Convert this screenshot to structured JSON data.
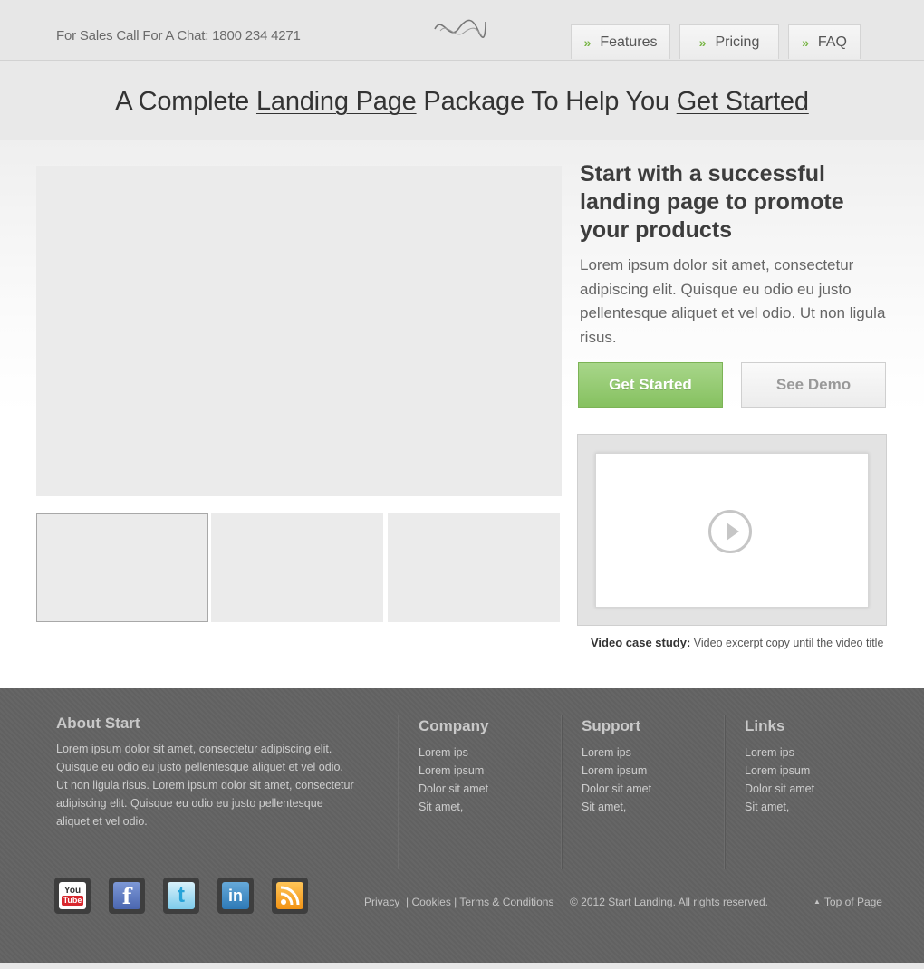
{
  "header": {
    "sales_text": "For Sales Call For A Chat: 1800 234 4271",
    "nav": [
      {
        "label": "Features"
      },
      {
        "label": "Pricing"
      },
      {
        "label": "FAQ"
      }
    ]
  },
  "headline": {
    "part1": "A Complete ",
    "link1": "Landing Page",
    "part2": " Package To Help You ",
    "link2": "Get Started"
  },
  "hero": {
    "title": "Start with a successful landing page to promote your products",
    "text": "Lorem ipsum dolor sit amet, consectetur adipiscing elit. Quisque eu odio eu justo pellentesque aliquet et vel odio. Ut non ligula risus.",
    "primary_button": "Get Started",
    "secondary_button": "See Demo",
    "video_caption_label": "Video case study:",
    "video_caption_text": " Video excerpt copy until the video title"
  },
  "footer": {
    "about_title": "About Start",
    "about_text": "Lorem ipsum dolor sit amet, consectetur adipiscing elit. Quisque eu odio eu justo pellentesque aliquet et vel odio. Ut non ligula risus.  Lorem ipsum dolor sit amet, consectetur adipiscing elit. Quisque eu odio eu justo pellentesque aliquet et vel odio.",
    "columns": [
      {
        "title": "Company",
        "items": [
          "Lorem ips",
          "Lorem ipsum",
          "Dolor sit amet",
          "Sit amet,"
        ]
      },
      {
        "title": "Support",
        "items": [
          "Lorem ips",
          "Lorem ipsum",
          "Dolor sit amet",
          "Sit amet,"
        ]
      },
      {
        "title": "Links",
        "items": [
          "Lorem ips",
          "Lorem ipsum",
          "Dolor sit amet",
          "Sit amet,"
        ]
      }
    ],
    "social": {
      "youtube_top": "You",
      "youtube_bottom": "Tube",
      "facebook": "f",
      "twitter": "t",
      "linkedin": "in"
    },
    "legal": {
      "privacy": "Privacy",
      "sep1": "  | ",
      "cookies": "Cookies",
      "sep2": " | ",
      "terms": "Terms & Conditions"
    },
    "copyright": "© 2012 Start Landing. All rights reserved.",
    "top_link": "Top of Page"
  },
  "colors": {
    "accent_green": "#86c160",
    "footer_bg": "#636363"
  }
}
